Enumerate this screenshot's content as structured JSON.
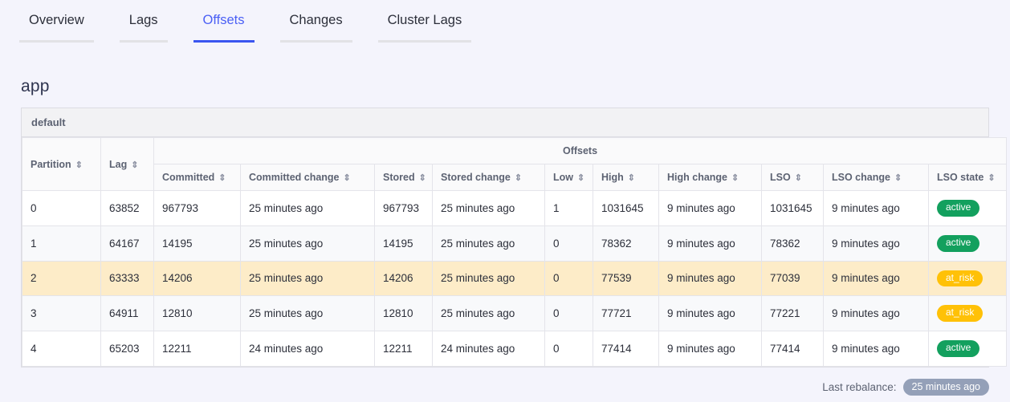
{
  "tabs": [
    {
      "label": "Overview",
      "active": false
    },
    {
      "label": "Lags",
      "active": false
    },
    {
      "label": "Offsets",
      "active": true
    },
    {
      "label": "Changes",
      "active": false
    },
    {
      "label": "Cluster Lags",
      "active": false
    }
  ],
  "page": {
    "title": "app",
    "group_label": "default"
  },
  "table": {
    "sort_icon": "⇕",
    "group_header": "Offsets",
    "headers": {
      "partition": "Partition",
      "lag": "Lag",
      "committed": "Committed",
      "committed_change": "Committed change",
      "stored": "Stored",
      "stored_change": "Stored change",
      "low": "Low",
      "high": "High",
      "high_change": "High change",
      "lso": "LSO",
      "lso_change": "LSO change",
      "lso_state": "LSO state"
    },
    "rows": [
      {
        "partition": "0",
        "lag": "63852",
        "committed": "967793",
        "committed_change": "25 minutes ago",
        "stored": "967793",
        "stored_change": "25 minutes ago",
        "low": "1",
        "high": "1031645",
        "high_change": "9 minutes ago",
        "lso": "1031645",
        "lso_change": "9 minutes ago",
        "lso_state": "active",
        "state_kind": "active",
        "row_style": "r-white"
      },
      {
        "partition": "1",
        "lag": "64167",
        "committed": "14195",
        "committed_change": "25 minutes ago",
        "stored": "14195",
        "stored_change": "25 minutes ago",
        "low": "0",
        "high": "78362",
        "high_change": "9 minutes ago",
        "lso": "78362",
        "lso_change": "9 minutes ago",
        "lso_state": "active",
        "state_kind": "active",
        "row_style": "r-stripe"
      },
      {
        "partition": "2",
        "lag": "63333",
        "committed": "14206",
        "committed_change": "25 minutes ago",
        "stored": "14206",
        "stored_change": "25 minutes ago",
        "low": "0",
        "high": "77539",
        "high_change": "9 minutes ago",
        "lso": "77039",
        "lso_change": "9 minutes ago",
        "lso_state": "at_risk",
        "state_kind": "at_risk",
        "row_style": "r-warn"
      },
      {
        "partition": "3",
        "lag": "64911",
        "committed": "12810",
        "committed_change": "25 minutes ago",
        "stored": "12810",
        "stored_change": "25 minutes ago",
        "low": "0",
        "high": "77721",
        "high_change": "9 minutes ago",
        "lso": "77221",
        "lso_change": "9 minutes ago",
        "lso_state": "at_risk",
        "state_kind": "at_risk",
        "row_style": "r-stripe"
      },
      {
        "partition": "4",
        "lag": "65203",
        "committed": "12211",
        "committed_change": "24 minutes ago",
        "stored": "12211",
        "stored_change": "24 minutes ago",
        "low": "0",
        "high": "77414",
        "high_change": "9 minutes ago",
        "lso": "77414",
        "lso_change": "9 minutes ago",
        "lso_state": "active",
        "state_kind": "active",
        "row_style": "r-white"
      }
    ]
  },
  "footer": {
    "label": "Last rebalance:",
    "value": "25 minutes ago"
  },
  "colors": {
    "page_bg": "#f4f4fc",
    "accent_blue": "#3a55f0",
    "tab_active_text": "#4a5ff5",
    "badge_active": "#13a05e",
    "badge_at_risk": "#ffc107",
    "row_highlight": "#fdecc8",
    "row_stripe": "#f8f9fb",
    "footer_pill": "#94a0b8"
  }
}
